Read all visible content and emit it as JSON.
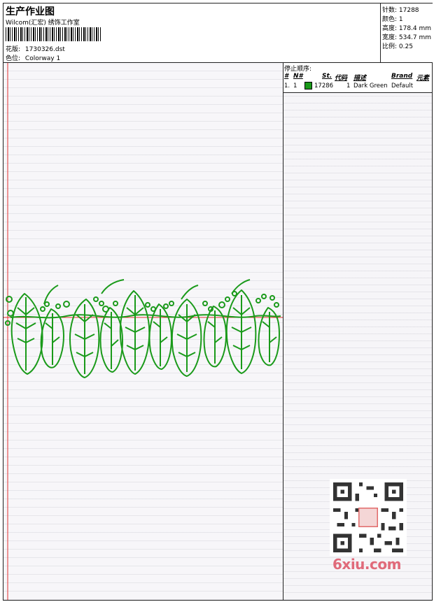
{
  "header": {
    "title": "生产作业图",
    "company": "Wilcom(汇宏) 绣饰工作室",
    "design_label": "花版:",
    "design_value": "1730326.dst",
    "colorway_label": "色位:",
    "colorway_value": "Colorway 1"
  },
  "stats": {
    "stitches": "针数: 17288",
    "colors": "颜色: 1",
    "height": "高度: 178.4 mm",
    "width": "宽度: 534.7 mm",
    "scale": "比例: 0.25"
  },
  "stop_sequence": {
    "title": "停止顺序:",
    "columns": [
      "#",
      "N#",
      "St.",
      "代码",
      "描述",
      "Brand",
      "元素"
    ],
    "rows": [
      {
        "index": "1.",
        "needle": "1",
        "color_hex": "#1a9a1a",
        "stitches": "17286",
        "code": "1",
        "description": "Dark Green",
        "brand": "Default"
      }
    ]
  },
  "design": {
    "thread_color": "#1a9a1a",
    "guide_color": "#e23030"
  },
  "watermark": {
    "text": "6xiu.com"
  }
}
